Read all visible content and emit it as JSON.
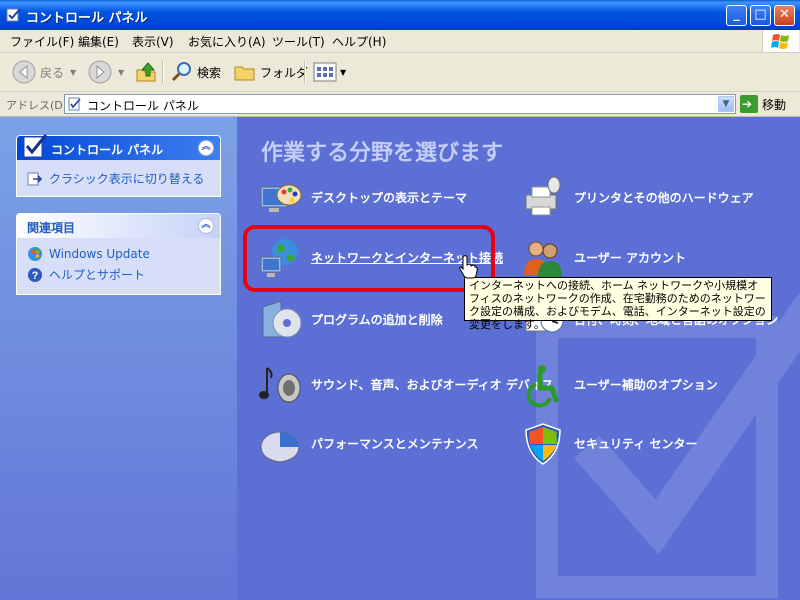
{
  "window": {
    "title": "コントロール パネル",
    "controls": {
      "minimize": "_",
      "maximize": "□",
      "close": "✕"
    }
  },
  "menu": [
    "ファイル(F)",
    "編集(E)",
    "表示(V)",
    "お気に入り(A)",
    "ツール(T)",
    "ヘルプ(H)"
  ],
  "toolbar": {
    "back": "戻る",
    "search": "検索",
    "folders": "フォルダ"
  },
  "address": {
    "label": "アドレス(D)",
    "value": "コントロール パネル",
    "go": "移動"
  },
  "sidebar": {
    "control_panel": {
      "title": "コントロール パネル",
      "links": [
        "クラシック表示に切り替える"
      ]
    },
    "related": {
      "title": "関連項目",
      "links": [
        "Windows Update",
        "ヘルプとサポート"
      ]
    }
  },
  "main": {
    "title": "作業する分野を選びます",
    "categories": [
      {
        "label": "デスクトップの表示とテーマ",
        "icon": "desktop-themes-icon"
      },
      {
        "label": "プリンタとその他のハードウェア",
        "icon": "printer-hardware-icon"
      },
      {
        "label": "ネットワークとインターネット接続",
        "icon": "network-internet-icon"
      },
      {
        "label": "ユーザー アカウント",
        "icon": "user-accounts-icon"
      },
      {
        "label": "プログラムの追加と削除",
        "icon": "add-remove-programs-icon"
      },
      {
        "label": "日付、時刻、地域と言語のオプション",
        "icon": "date-time-region-icon"
      },
      {
        "label": "サウンド、音声、およびオーディオ デバイス",
        "icon": "sound-audio-icon"
      },
      {
        "label": "ユーザー補助のオプション",
        "icon": "accessibility-icon"
      },
      {
        "label": "パフォーマンスとメンテナンス",
        "icon": "performance-maintenance-icon"
      },
      {
        "label": "セキュリティ センター",
        "icon": "security-center-icon"
      }
    ]
  },
  "tooltip": "インターネットへの接続、ホーム ネットワークや小規模オフィスのネットワークの作成、在宅勤務のためのネットワーク設定の構成、およびモデム、電話、インターネット設定の変更をします。",
  "colors": {
    "highlight": "#e8000e",
    "main_bg": "#5b6fd4",
    "sidebar_link": "#215dc6"
  }
}
